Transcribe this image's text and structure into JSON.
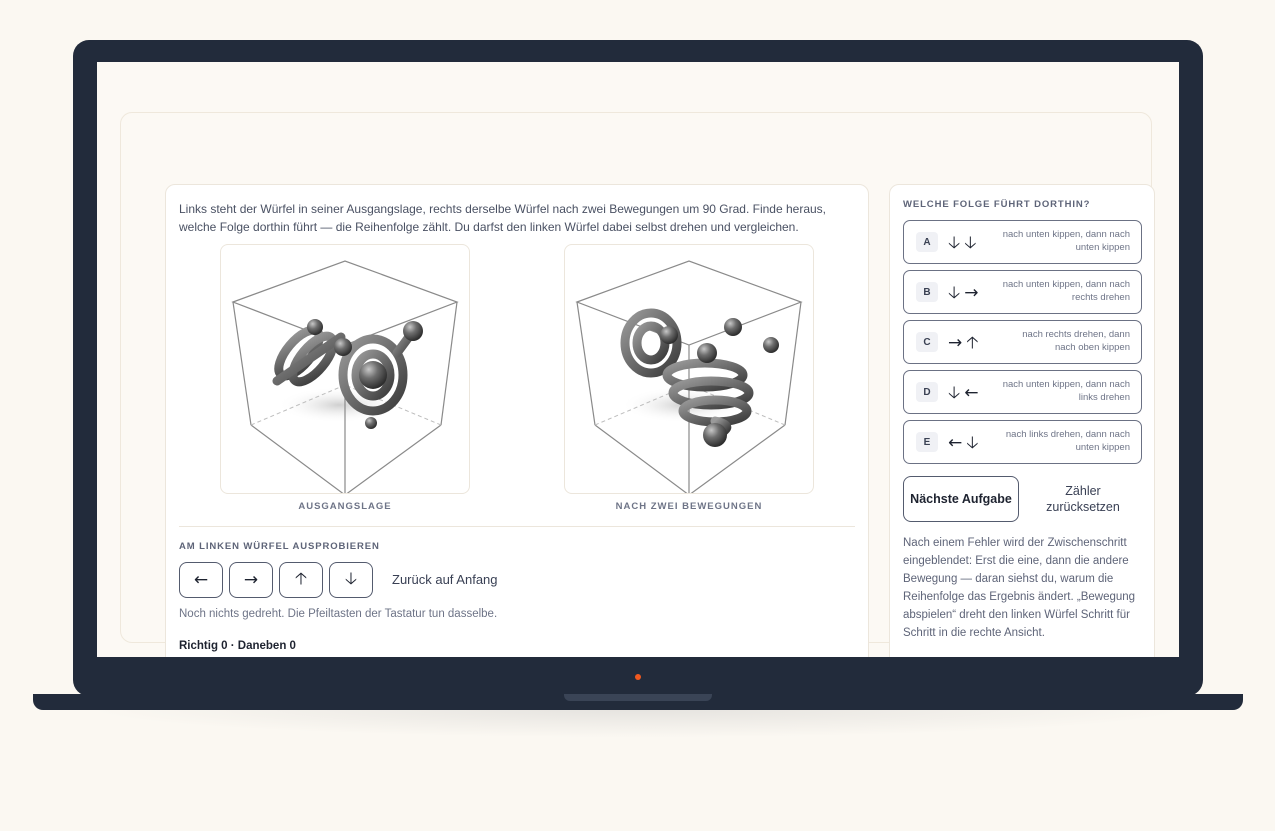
{
  "intro_text": "Links steht der Würfel in seiner Ausgangslage, rechts derselbe Würfel nach zwei Bewegungen um 90 Grad. Finde heraus, welche Folge dorthin führt — die Reihenfolge zählt. Du darfst den linken Würfel dabei selbst drehen und vergleichen.",
  "cubes": {
    "left_caption": "AUSGANGSLAGE",
    "right_caption": "NACH ZWEI BEWEGUNGEN"
  },
  "try_section": {
    "label": "AM LINKEN WÜRFEL AUSPROBIEREN",
    "buttons": [
      {
        "symbol": "←",
        "icon": "arrow-left-icon"
      },
      {
        "symbol": "→",
        "icon": "arrow-right-icon"
      },
      {
        "symbol": "🡡",
        "icon": "arrow-up-icon"
      },
      {
        "symbol": "🡣",
        "icon": "arrow-down-icon"
      }
    ],
    "reset_label": "Zurück auf Anfang",
    "hint": "Noch nichts gedreht. Die Pfeiltasten der Tastatur tun dasselbe.",
    "score": "Richtig 0 · Daneben 0"
  },
  "question": {
    "label": "WELCHE FOLGE FÜHRT DORTHIN?",
    "options": [
      {
        "letter": "A",
        "arrows": "🡣🡣",
        "text": "nach unten kippen, dann nach unten kippen"
      },
      {
        "letter": "B",
        "arrows": "🡣→",
        "text": "nach unten kippen, dann nach rechts drehen"
      },
      {
        "letter": "C",
        "arrows": "→🡡",
        "text": "nach rechts drehen, dann nach oben kippen"
      },
      {
        "letter": "D",
        "arrows": "🡣←",
        "text": "nach unten kippen, dann nach links drehen"
      },
      {
        "letter": "E",
        "arrows": "←🡣",
        "text": "nach links drehen, dann nach unten kippen"
      }
    ],
    "next_label": "Nächste Aufgabe",
    "reset_counter_label": "Zähler zurücksetzen",
    "note": "Nach einem Fehler wird der Zwischenschritt eingeblendet: Erst die eine, dann die andere Bewegung — daran siehst du, warum die Reihenfolge das Ergebnis ändert. „Bewegung abspielen“ dreht den linken Würfel Schritt für Schritt in die rechte Ansicht."
  }
}
